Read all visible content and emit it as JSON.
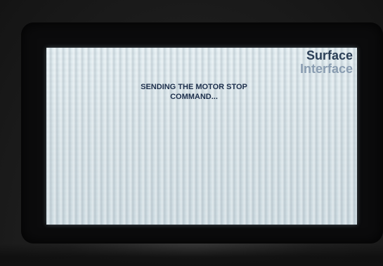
{
  "device": {
    "brand_line1": "Surface",
    "brand_line2": "Interface"
  },
  "screen": {
    "status_message": "SENDING THE MOTOR STOP\nCOMMAND..."
  }
}
